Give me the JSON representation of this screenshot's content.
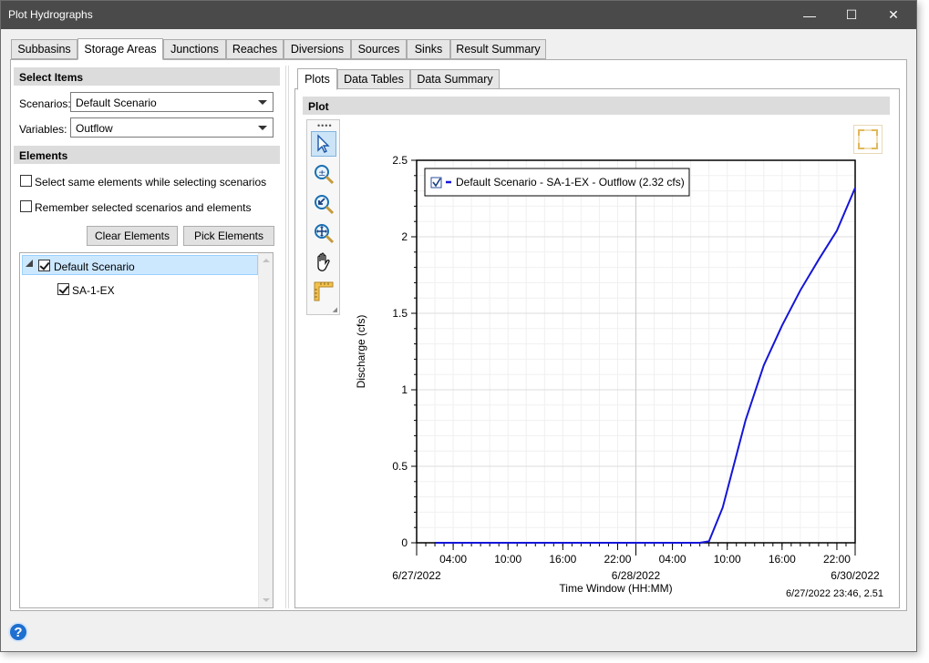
{
  "window": {
    "title": "Plot Hydrographs",
    "minimize_icon": "minimize-icon",
    "maximize_icon": "maximize-icon",
    "close_icon": "close-icon"
  },
  "main_tabs": [
    "Subbasins",
    "Storage Areas",
    "Junctions",
    "Reaches",
    "Diversions",
    "Sources",
    "Sinks",
    "Result Summary"
  ],
  "active_main_tab": "Storage Areas",
  "left": {
    "select_items_header": "Select Items",
    "scenarios_label": "Scenarios:",
    "scenarios_value": "Default Scenario",
    "variables_label": "Variables:",
    "variables_value": "Outflow",
    "elements_header": "Elements",
    "checkbox_same": "Select same elements while selecting scenarios",
    "checkbox_remember": "Remember selected scenarios and elements",
    "clear_button": "Clear Elements",
    "pick_button": "Pick Elements",
    "tree": {
      "root": "Default Scenario",
      "child": "SA-1-EX"
    }
  },
  "right": {
    "tabs": [
      "Plots",
      "Data Tables",
      "Data Summary"
    ],
    "active_tab": "Plots",
    "plot_header": "Plot",
    "toolbar_tools": [
      "pointer-icon",
      "zoom-icon",
      "zoom-previous-icon",
      "zoom-extents-icon",
      "pan-hand-icon",
      "measure-icon"
    ],
    "status": "6/27/2022 23:46, 2.51"
  },
  "chart_data": {
    "type": "line",
    "title": "",
    "xlabel": "Time Window (HH:MM)",
    "ylabel": "Discharge (cfs)",
    "ylim": [
      0,
      2.5
    ],
    "yticks": [
      "0",
      "0.5",
      "1",
      "1.5",
      "2",
      "2.5"
    ],
    "xlim_hours": [
      0,
      72
    ],
    "xticks": [
      {
        "t": 4,
        "label": "04:00"
      },
      {
        "t": 10,
        "label": "10:00"
      },
      {
        "t": 16,
        "label": "16:00"
      },
      {
        "t": 22,
        "label": "22:00"
      },
      {
        "t": 28,
        "label": "04:00"
      },
      {
        "t": 34,
        "label": "10:00"
      },
      {
        "t": 40,
        "label": "16:00"
      },
      {
        "t": 46,
        "label": "22:00"
      }
    ],
    "date_labels": [
      {
        "t": 0,
        "label": "6/27/2022"
      },
      {
        "t": 24,
        "label": "6/28/2022"
      },
      {
        "t": 48,
        "label": "6/30/2022"
      }
    ],
    "grid": true,
    "legend_position": "top-left",
    "series": [
      {
        "name": "Default Scenario - SA-1-EX - Outflow (2.32 cfs)",
        "color": "#1515d8",
        "x": [
          2,
          10,
          20,
          31,
          32,
          33.5,
          36,
          38,
          40,
          42,
          44,
          46,
          48
        ],
        "y": [
          0,
          0,
          0,
          0,
          0.01,
          0.23,
          0.8,
          1.16,
          1.42,
          1.65,
          1.85,
          2.04,
          2.32
        ]
      }
    ]
  }
}
